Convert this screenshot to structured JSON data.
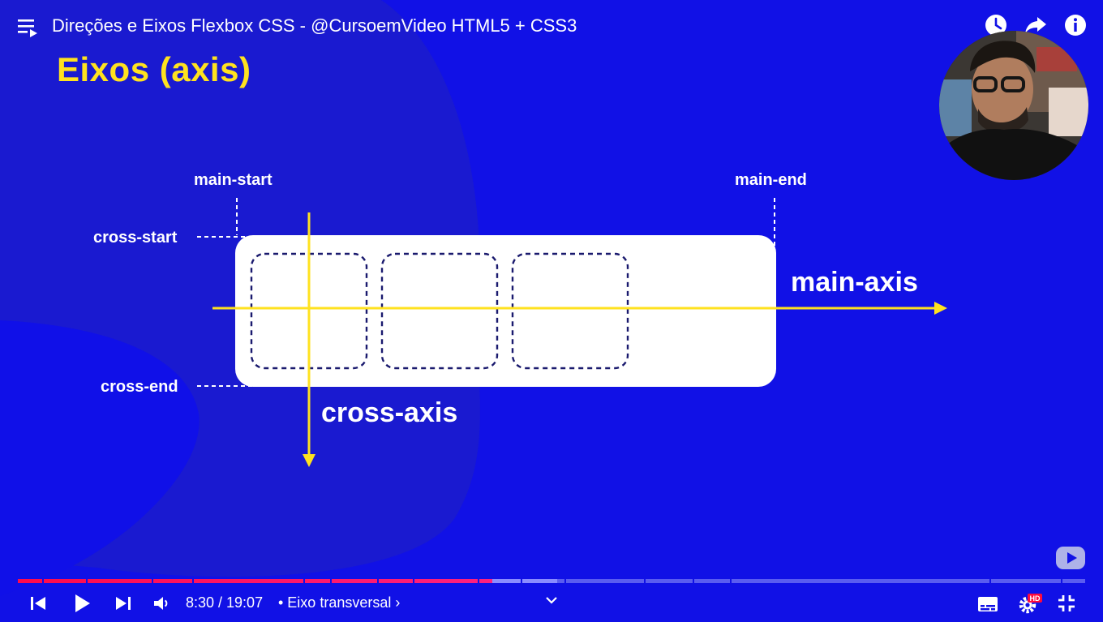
{
  "video": {
    "title": "Direções e Eixos Flexbox CSS - @CursoemVideo HTML5 + CSS3"
  },
  "slide": {
    "heading": "Eixos (axis)",
    "labels": {
      "main_start": "main-start",
      "main_end": "main-end",
      "cross_start": "cross-start",
      "cross_end": "cross-end",
      "main_axis": "main-axis",
      "cross_axis": "cross-axis"
    }
  },
  "player": {
    "current_time": "8:30",
    "duration": "19:07",
    "time_display": "8:30 / 19:07",
    "chapter": "• Eixo transversal ›",
    "quality_badge": "HD",
    "progress_fraction": 0.4444
  },
  "icons": {
    "playlist": "playlist-icon",
    "watch_later": "clock-icon",
    "share": "share-icon",
    "info": "info-icon",
    "prev": "previous-icon",
    "play": "play-icon",
    "next": "next-icon",
    "volume": "volume-icon",
    "chevron": "chevron-down-icon",
    "subtitles": "subtitles-icon",
    "settings": "gear-icon",
    "exit_fullscreen": "exit-fullscreen-icon"
  },
  "colors": {
    "background": "#1111e6",
    "accent_yellow": "#ffe21f",
    "progress_played": "#ff0a4c",
    "progress_buffered": "#8a8cff",
    "progress_track": "#5a5cf0"
  }
}
